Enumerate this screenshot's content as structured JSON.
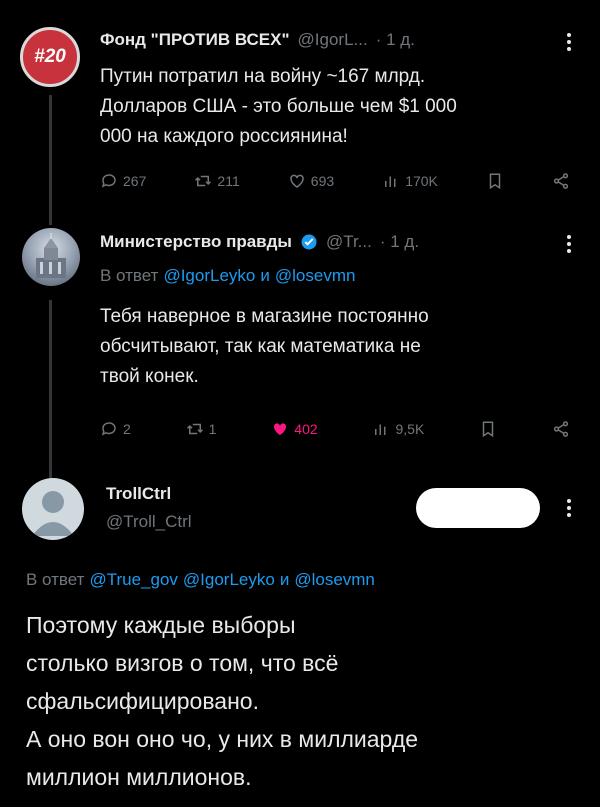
{
  "tweet1": {
    "avatar_badge": "#20",
    "name": "Фонд \"ПРОТИВ ВСЕХ\"",
    "handle": "@IgorL...",
    "time": "· 1 д.",
    "text_lines": [
      "Путин потратил на войну ~167 млрд.",
      "Долларов США - это больше чем $1 000",
      "000 на каждого россиянина!"
    ],
    "replies": "267",
    "retweets": "211",
    "likes": "693",
    "views": "170K"
  },
  "tweet2": {
    "name": "Министерство правды",
    "handle": "@Tr...",
    "time": "· 1 д.",
    "reply_to_prefix": "В ответ",
    "reply_to_user1": "@IgorLeyko",
    "reply_to_and": "и",
    "reply_to_user2": "@losevmn",
    "text_lines": [
      "Тебя наверное в магазине постоянно",
      "обсчитывают, так как математика не",
      "твой конек."
    ],
    "replies": "2",
    "retweets": "1",
    "likes": "402",
    "views": "9,5K"
  },
  "tweet3": {
    "name": "TrollCtrl",
    "handle": "@Troll_Ctrl",
    "reply_to_prefix": "В ответ",
    "reply_to_user1": "@True_gov",
    "reply_to_user2": "@IgorLeyko",
    "reply_to_and": "и",
    "reply_to_user3": "@losevmn",
    "text_lines": [
      "Поэтому каждые выборы",
      "столько визгов о том, что всё",
      "сфальсифицировано.",
      "А оно вон оно чо, у них в миллиарде",
      "миллион миллионов."
    ]
  },
  "colors": {
    "accent": "#1d9bf0",
    "like_active": "#f91880",
    "muted": "#71767b",
    "badge_red": "#c8323c"
  }
}
